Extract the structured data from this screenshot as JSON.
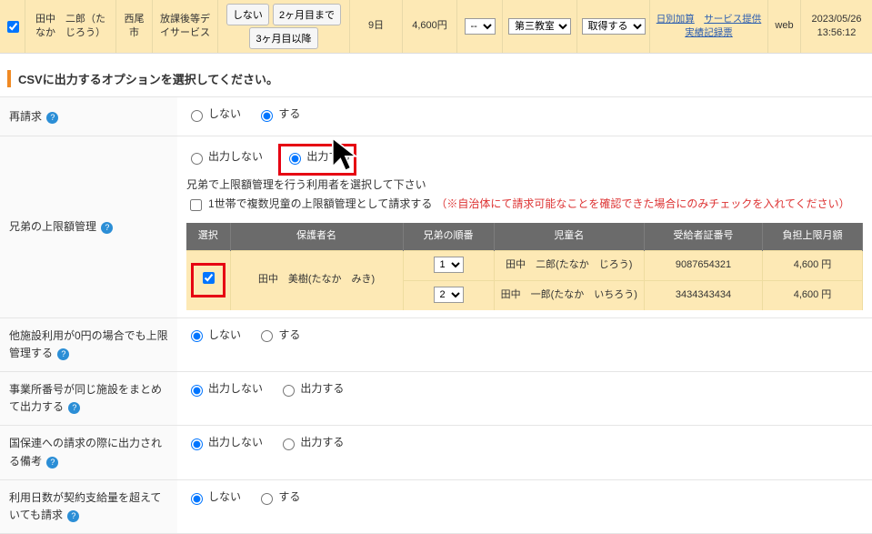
{
  "top": {
    "name": "田中　二郎（たなか　じろう）",
    "city": "西尾市",
    "service": "放課後等デイサービス",
    "btn_shinai": "しない",
    "btn_2m": "2ヶ月目まで",
    "btn_3m": "3ヶ月目以降",
    "days": "9日",
    "amount": "4,600円",
    "sel1": "--",
    "sel2": "第三教室",
    "sel3": "取得する",
    "link1": "日別加算",
    "link2": "サービス提供実績記録票",
    "web": "web",
    "timestamp": "2023/05/26 13:56:12"
  },
  "section_title": "CSVに出力するオプションを選択してください。",
  "rows": {
    "reseikyu": {
      "label": "再請求",
      "opt_no": "しない",
      "opt_yes": "する"
    },
    "siblings": {
      "label": "兄弟の上限額管理",
      "opt_no": "出力しない",
      "opt_yes": "出力する",
      "line2": "兄弟で上限額管理を行う利用者を選択して下さい",
      "chk_label": "1世帯で複数児童の上限額管理として請求する",
      "chk_warn": "（※自治体にて請求可能なことを確認できた場合にのみチェックを入れてください）",
      "th_select": "選択",
      "th_guardian": "保護者名",
      "th_order": "兄弟の順番",
      "th_child": "児童名",
      "th_cert": "受給者証番号",
      "th_cap": "負担上限月額",
      "guardian": "田中　美樹(たなか　みき)",
      "order1": "1",
      "order2": "2",
      "child1": "田中　二郎(たなか　じろう)",
      "child2": "田中　一郎(たなか　いちろう)",
      "cert1": "9087654321",
      "cert2": "3434343434",
      "cap1": "4,600 円",
      "cap2": "4,600 円"
    },
    "zeroyen": {
      "label": "他施設利用が0円の場合でも上限管理する",
      "opt_no": "しない",
      "opt_yes": "する"
    },
    "samefac": {
      "label": "事業所番号が同じ施設をまとめて出力する",
      "opt_no": "出力しない",
      "opt_yes": "出力する"
    },
    "kokuho": {
      "label": "国保連への請求の際に出力される備考",
      "opt_no": "出力しない",
      "opt_yes": "出力する"
    },
    "overdays": {
      "label": "利用日数が契約支給量を超えていても請求",
      "opt_no": "しない",
      "opt_yes": "する"
    }
  },
  "help_glyph": "?"
}
